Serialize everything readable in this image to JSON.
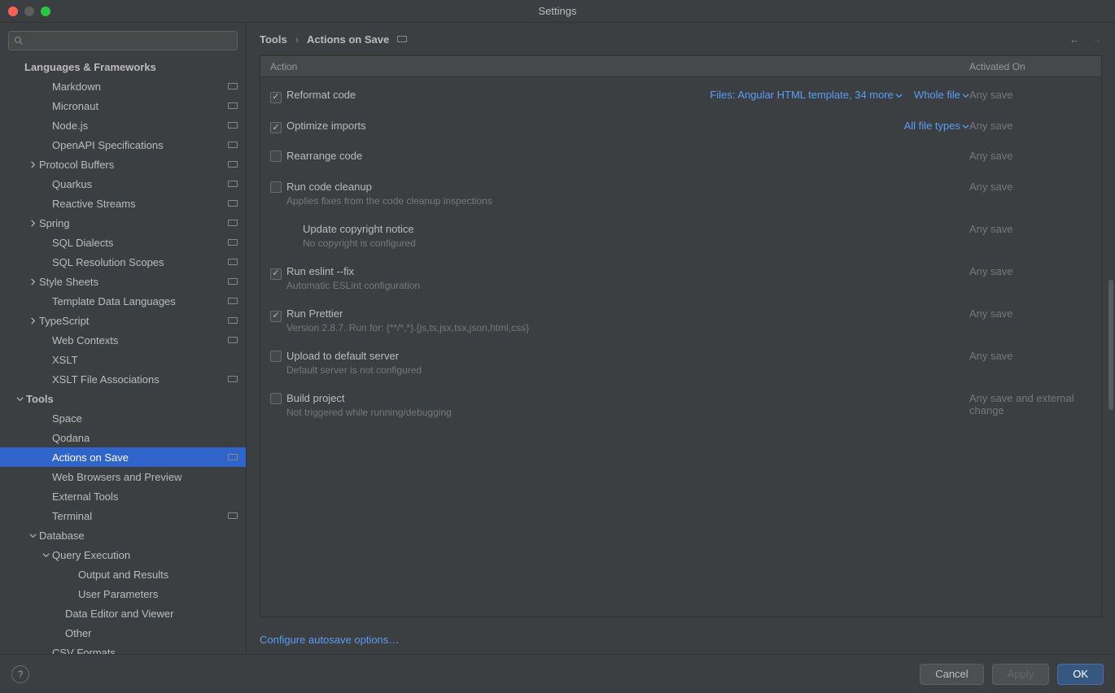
{
  "window": {
    "title": "Settings"
  },
  "search": {
    "placeholder": ""
  },
  "sidebar": {
    "section_header": "Languages & Frameworks",
    "items": [
      {
        "label": "Markdown",
        "indent": 48,
        "chevron": "",
        "marker": true
      },
      {
        "label": "Micronaut",
        "indent": 48,
        "chevron": "",
        "marker": true
      },
      {
        "label": "Node.js",
        "indent": 48,
        "chevron": "",
        "marker": true
      },
      {
        "label": "OpenAPI Specifications",
        "indent": 48,
        "chevron": "",
        "marker": true
      },
      {
        "label": "Protocol Buffers",
        "indent": 32,
        "chevron": "right",
        "marker": true
      },
      {
        "label": "Quarkus",
        "indent": 48,
        "chevron": "",
        "marker": true
      },
      {
        "label": "Reactive Streams",
        "indent": 48,
        "chevron": "",
        "marker": true
      },
      {
        "label": "Spring",
        "indent": 32,
        "chevron": "right",
        "marker": true
      },
      {
        "label": "SQL Dialects",
        "indent": 48,
        "chevron": "",
        "marker": true
      },
      {
        "label": "SQL Resolution Scopes",
        "indent": 48,
        "chevron": "",
        "marker": true
      },
      {
        "label": "Style Sheets",
        "indent": 32,
        "chevron": "right",
        "marker": true
      },
      {
        "label": "Template Data Languages",
        "indent": 48,
        "chevron": "",
        "marker": true
      },
      {
        "label": "TypeScript",
        "indent": 32,
        "chevron": "right",
        "marker": true
      },
      {
        "label": "Web Contexts",
        "indent": 48,
        "chevron": "",
        "marker": true
      },
      {
        "label": "XSLT",
        "indent": 48,
        "chevron": "",
        "marker": false
      },
      {
        "label": "XSLT File Associations",
        "indent": 48,
        "chevron": "",
        "marker": true
      },
      {
        "label": "Tools",
        "indent": 16,
        "chevron": "down",
        "marker": false,
        "bold": true
      },
      {
        "label": "Space",
        "indent": 48,
        "chevron": "",
        "marker": false
      },
      {
        "label": "Qodana",
        "indent": 48,
        "chevron": "",
        "marker": false
      },
      {
        "label": "Actions on Save",
        "indent": 48,
        "chevron": "",
        "marker": true,
        "selected": true
      },
      {
        "label": "Web Browsers and Preview",
        "indent": 48,
        "chevron": "",
        "marker": false
      },
      {
        "label": "External Tools",
        "indent": 48,
        "chevron": "",
        "marker": false
      },
      {
        "label": "Terminal",
        "indent": 48,
        "chevron": "",
        "marker": true
      },
      {
        "label": "Database",
        "indent": 32,
        "chevron": "down",
        "marker": false
      },
      {
        "label": "Query Execution",
        "indent": 48,
        "chevron": "down",
        "marker": false
      },
      {
        "label": "Output and Results",
        "indent": 80,
        "chevron": "",
        "marker": false
      },
      {
        "label": "User Parameters",
        "indent": 80,
        "chevron": "",
        "marker": false
      },
      {
        "label": "Data Editor and Viewer",
        "indent": 64,
        "chevron": "",
        "marker": false
      },
      {
        "label": "Other",
        "indent": 64,
        "chevron": "",
        "marker": false
      },
      {
        "label": "CSV Formats",
        "indent": 48,
        "chevron": "",
        "marker": false
      }
    ]
  },
  "breadcrumb": {
    "root": "Tools",
    "current": "Actions on Save"
  },
  "table": {
    "col_action": "Action",
    "col_activated": "Activated On"
  },
  "actions": [
    {
      "checked": true,
      "label": "Reformat code",
      "sub": "",
      "options": [
        {
          "text": "Files: Angular HTML template, 34 more"
        },
        {
          "text": "Whole file"
        }
      ],
      "activated": "Any save"
    },
    {
      "checked": true,
      "label": "Optimize imports",
      "sub": "",
      "options": [
        {
          "text": "All file types"
        }
      ],
      "activated": "Any save"
    },
    {
      "checked": false,
      "label": "Rearrange code",
      "sub": "",
      "options": [],
      "activated": "Any save"
    },
    {
      "checked": false,
      "label": "Run code cleanup",
      "sub": "Applies fixes from the code cleanup inspections",
      "options": [],
      "activated": "Any save"
    },
    {
      "checked": false,
      "label": "Update copyright notice",
      "sub": "No copyright is configured",
      "options": [],
      "activated": "Any save",
      "indent": true,
      "nocheck": true
    },
    {
      "checked": true,
      "label": "Run eslint --fix",
      "sub": "Automatic ESLint configuration",
      "options": [],
      "activated": "Any save"
    },
    {
      "checked": true,
      "label": "Run Prettier",
      "sub": "Version 2.8.7. Run for: {**/*,*}.{js,ts,jsx,tsx,json,html,css}",
      "options": [],
      "activated": "Any save"
    },
    {
      "checked": false,
      "label": "Upload to default server",
      "sub": "Default server is not configured",
      "options": [],
      "activated": "Any save"
    },
    {
      "checked": false,
      "label": "Build project",
      "sub": "Not triggered while running/debugging",
      "options": [],
      "activated": "Any save and external change"
    }
  ],
  "config_link": "Configure autosave options…",
  "footer": {
    "cancel": "Cancel",
    "apply": "Apply",
    "ok": "OK"
  }
}
